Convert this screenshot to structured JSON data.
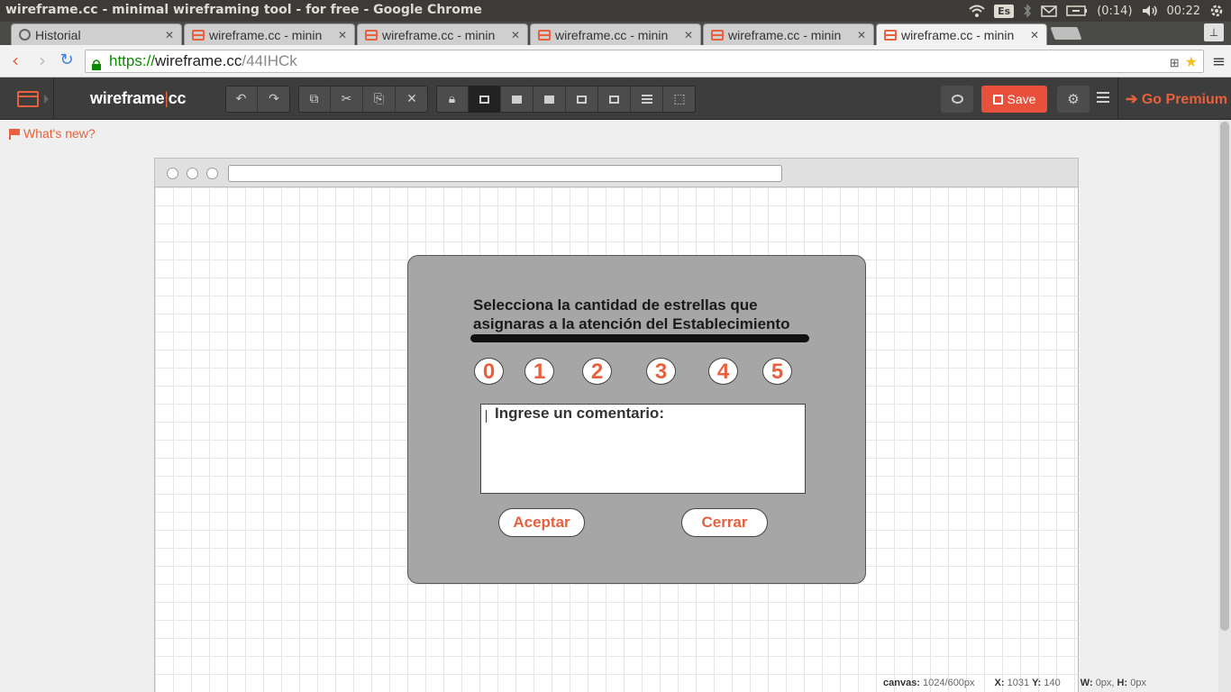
{
  "os": {
    "window_title": "wireframe.cc - minimal wireframing tool - for free - Google Chrome",
    "lang": "Es",
    "battery": "(0:14)",
    "clock": "00:22"
  },
  "tabs": [
    {
      "label": "Historial",
      "icon": "history-clock-icon"
    },
    {
      "label": "wireframe.cc - minin",
      "icon": "wireframe-favicon"
    },
    {
      "label": "wireframe.cc - minin",
      "icon": "wireframe-favicon"
    },
    {
      "label": "wireframe.cc - minin",
      "icon": "wireframe-favicon"
    },
    {
      "label": "wireframe.cc - minin",
      "icon": "wireframe-favicon"
    },
    {
      "label": "wireframe.cc - minin",
      "icon": "wireframe-favicon",
      "active": true
    }
  ],
  "omnibox": {
    "protocol": "https://",
    "host": "wireframe.cc",
    "path": "/44IHCk"
  },
  "app": {
    "brand_left": "wireframe",
    "brand_sep": "|",
    "brand_right": "cc",
    "save_label": "Save",
    "premium_label": "Go Premium",
    "whats_new": "What's new?",
    "accent": "#e8603c"
  },
  "dialog": {
    "title_line1": "Selecciona la cantidad de estrellas que",
    "title_line2": "asignaras a la atención del Establecimiento",
    "ratings": [
      "0",
      "1",
      "2",
      "3",
      "4",
      "5"
    ],
    "comment_placeholder": "Ingrese un comentario:",
    "accept_label": "Aceptar",
    "close_label": "Cerrar"
  },
  "status": {
    "canvas_label": "canvas:",
    "canvas_value": "1024/600px",
    "x_label": "X:",
    "x_value": "1031",
    "y_label": "Y:",
    "y_value": "140",
    "w_label": "W:",
    "w_value": "0px,",
    "h_label": "H:",
    "h_value": "0px"
  }
}
